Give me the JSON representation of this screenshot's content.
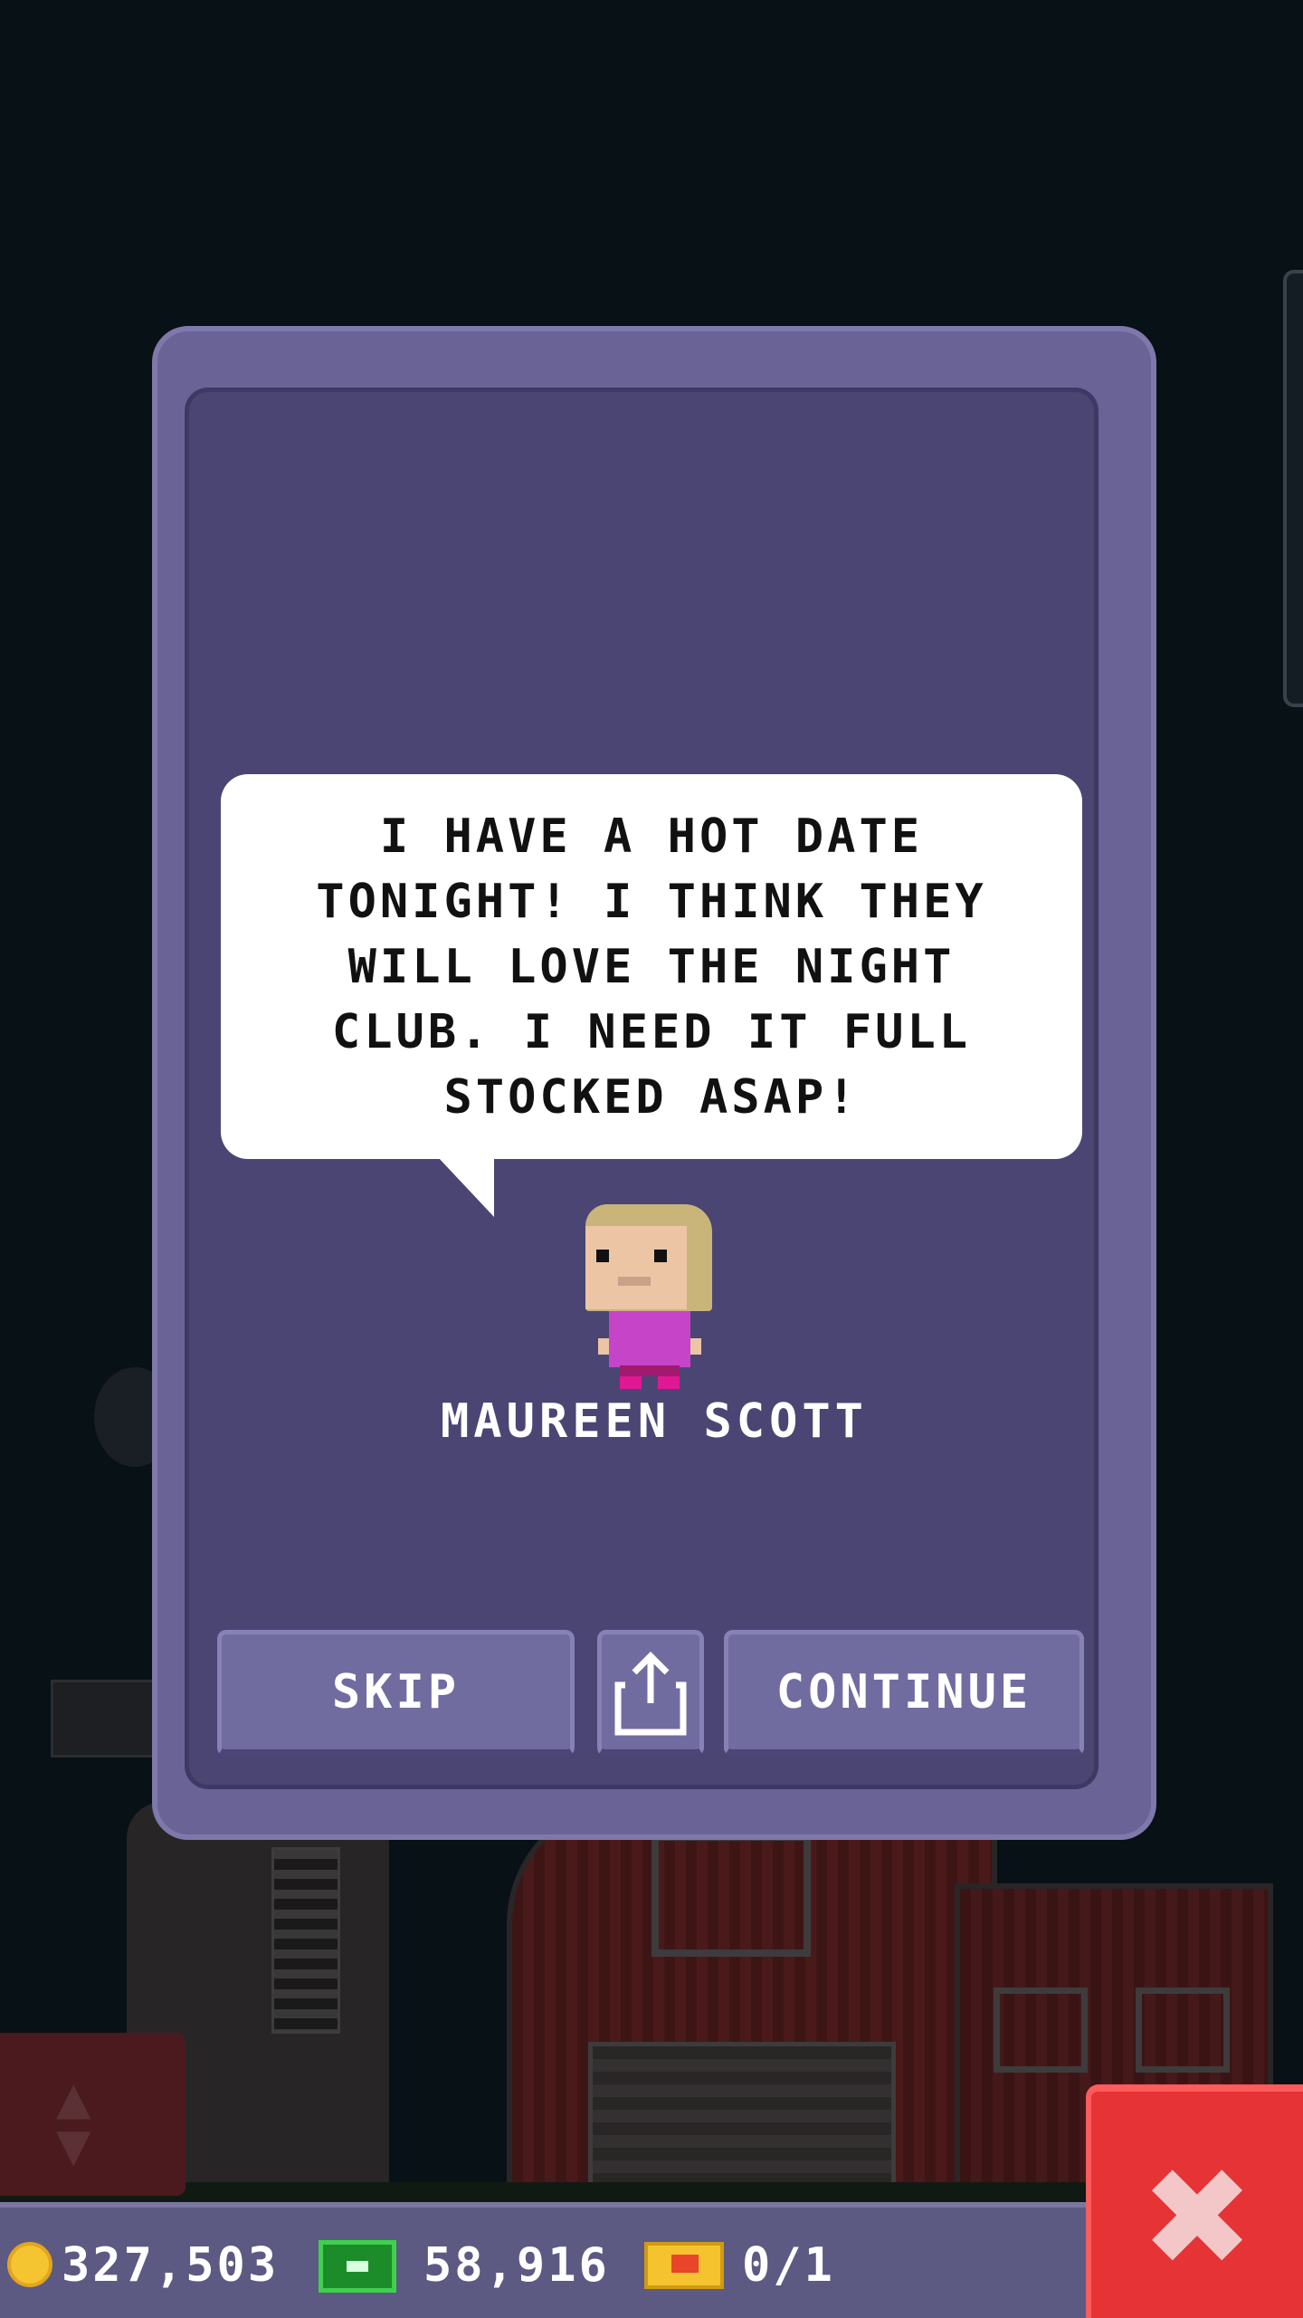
{
  "dialog": {
    "message": "I HAVE A HOT DATE TONIGHT! I THINK THEY WILL LOVE THE NIGHT CLUB. I NEED IT FULL STOCKED ASAP!",
    "character_name": "MAUREEN SCOTT",
    "buttons": {
      "skip": "SKIP",
      "share_icon": "share-icon",
      "continue": "CONTINUE"
    }
  },
  "resources": {
    "coins": "327,503",
    "bux": "58,916",
    "tickets": "0/1"
  },
  "icons": {
    "coin": "coin-icon",
    "bux": "bux-icon",
    "ticket": "ticket-icon",
    "close": "close-icon",
    "elevator": "elevator-arrows-icon"
  },
  "colors": {
    "modal_border": "#7e78ac",
    "modal_bg": "#4a4573",
    "button": "#716ca0",
    "close_button": "#e53336",
    "character_shirt": "#c644c8"
  }
}
